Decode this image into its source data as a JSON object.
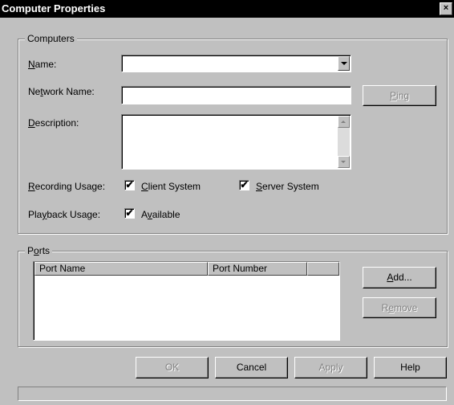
{
  "window": {
    "title": "Computer Properties",
    "close_label": "×"
  },
  "computers": {
    "group_label": "Computers",
    "name_label": "Name:",
    "name_value": "",
    "network_name_label": "Network Name:",
    "network_name_value": "",
    "ping_label": "Ping",
    "description_label": "Description:",
    "description_value": "",
    "recording_usage_label": "Recording Usage:",
    "client_system_label": "Client System",
    "client_system_checked": true,
    "server_system_label": "Server System",
    "server_system_checked": true,
    "playback_usage_label": "Playback Usage:",
    "available_label": "Available",
    "available_checked": true
  },
  "ports": {
    "group_label": "Ports",
    "columns": [
      "Port Name",
      "Port Number",
      ""
    ],
    "rows": [],
    "add_label": "Add...",
    "remove_label": "Remove"
  },
  "footer": {
    "ok_label": "OK",
    "cancel_label": "Cancel",
    "apply_label": "Apply",
    "help_label": "Help",
    "status_text": ""
  },
  "check_glyph": "✔"
}
